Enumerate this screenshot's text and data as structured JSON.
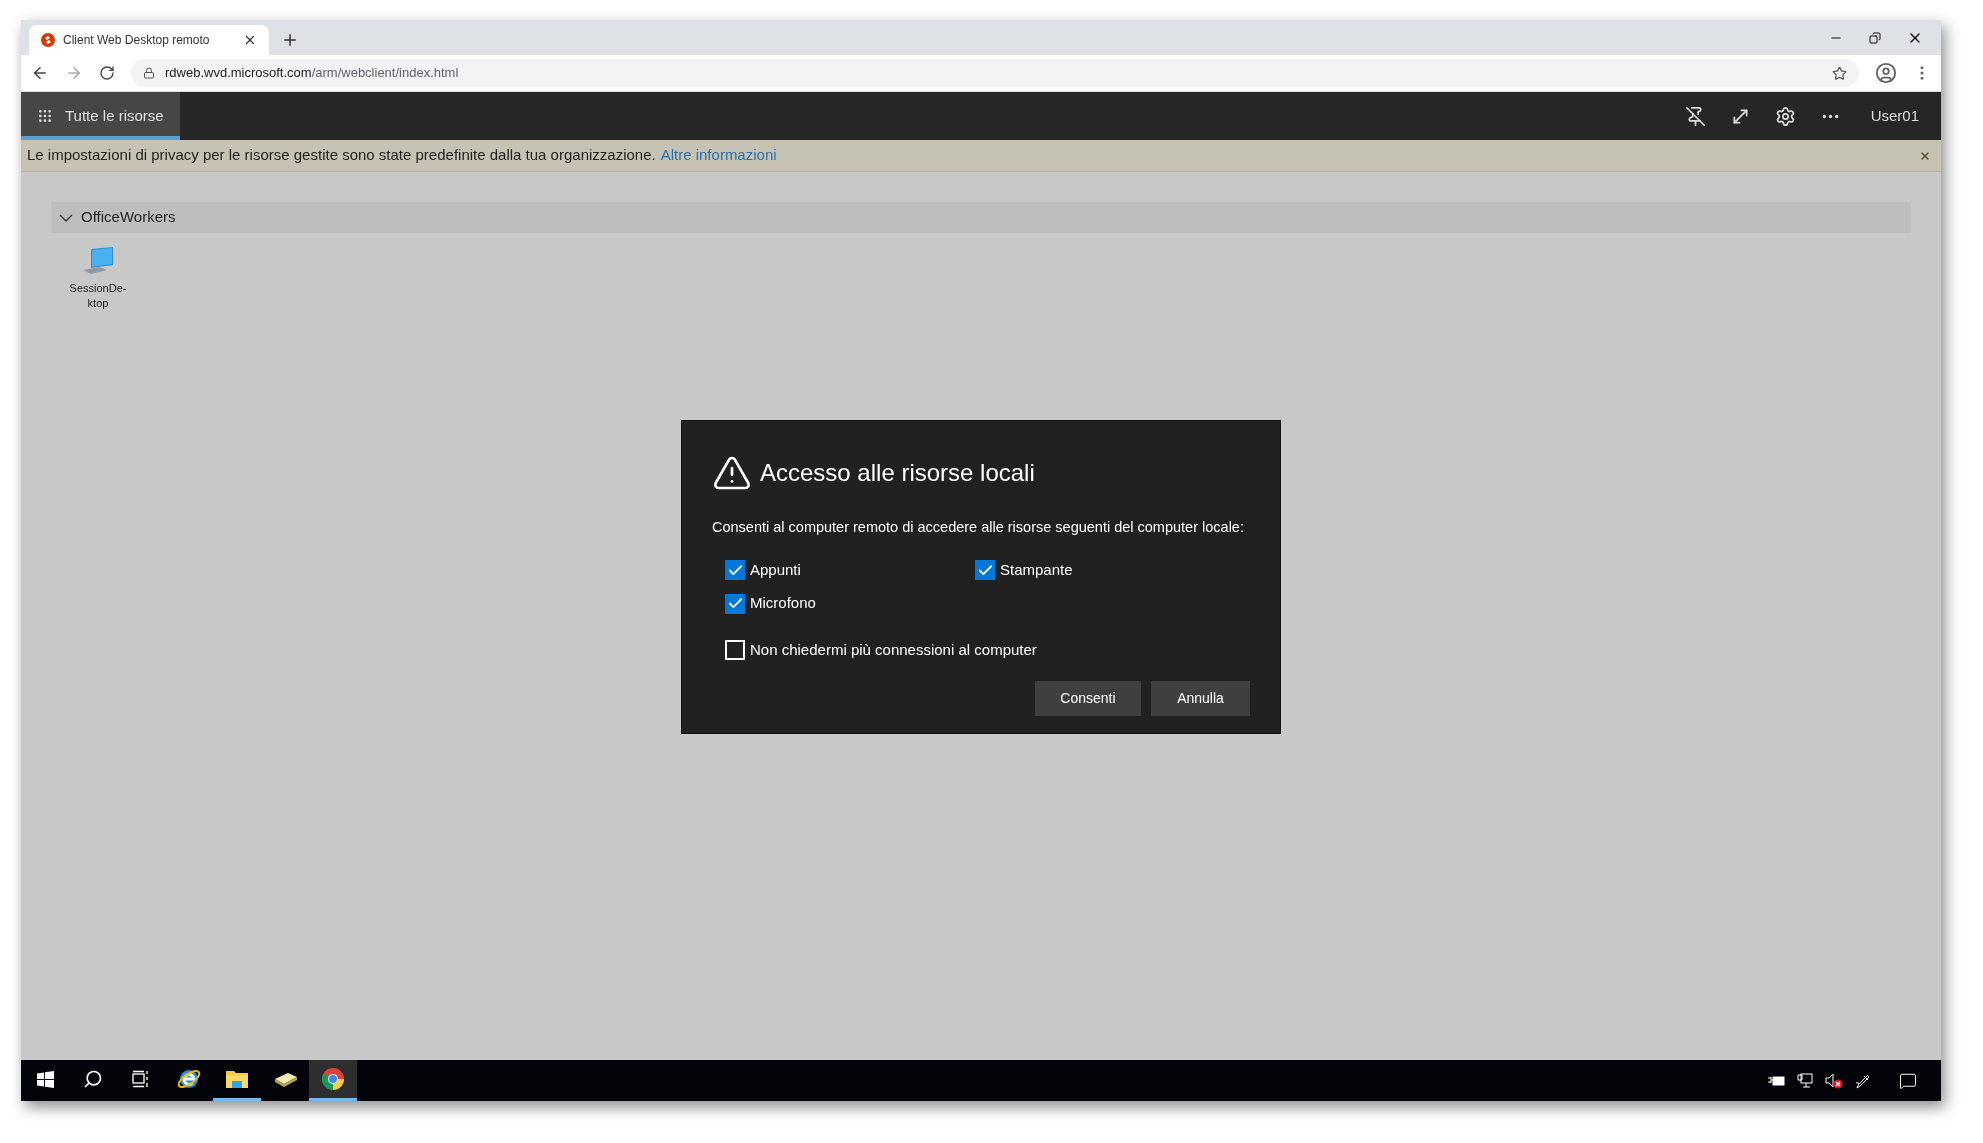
{
  "browser": {
    "tab": {
      "title": "Client Web Desktop remoto",
      "selected": true
    },
    "url": {
      "host": "rdweb.wvd.microsoft.com",
      "path": "/arm/webclient/index.html"
    }
  },
  "app_bar": {
    "nav": {
      "label": "Tutte le risorse",
      "selected": true
    },
    "user": "User01"
  },
  "banner": {
    "text": "Le impostazioni di privacy per le risorse gestite sono state predefinite dalla tua organizzazione.",
    "link": "Altre informazioni"
  },
  "group": {
    "name": "OfficeWorkers",
    "expanded": true,
    "resources": [
      {
        "label_lines": [
          "SessionDe-",
          "ktop"
        ]
      }
    ]
  },
  "dialog": {
    "title": "Accesso alle risorse locali",
    "prompt": "Consenti al computer remoto di accedere alle risorse seguenti del computer locale:",
    "options": [
      {
        "label": "Appunti",
        "checked": true
      },
      {
        "label": "Stampante",
        "checked": true
      },
      {
        "label": "Microfono",
        "checked": true
      }
    ],
    "remember": {
      "label": "Non chiedermi più connessioni al computer",
      "checked": false
    },
    "buttons": [
      "Consenti",
      "Annulla"
    ]
  },
  "taskbar": {
    "apps": [
      {
        "kind": "start",
        "running": false,
        "selected": false
      },
      {
        "kind": "search",
        "running": false,
        "selected": false
      },
      {
        "kind": "taskview",
        "running": false,
        "selected": false
      },
      {
        "kind": "ie",
        "running": false,
        "selected": false
      },
      {
        "kind": "explorer",
        "running": true,
        "selected": false
      },
      {
        "kind": "notes",
        "running": false,
        "selected": false
      },
      {
        "kind": "chrome",
        "running": true,
        "selected": true
      }
    ]
  }
}
